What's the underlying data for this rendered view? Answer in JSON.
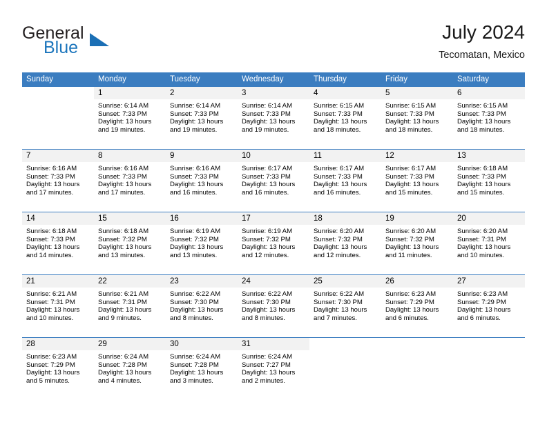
{
  "brand": {
    "word1": "General",
    "word2": "Blue",
    "triangle_icon": "triangle-icon",
    "color_dark": "#231f20",
    "color_blue": "#1b75bc"
  },
  "header": {
    "title": "July 2024",
    "subtitle": "Tecomatan, Mexico"
  },
  "theme": {
    "header_bg": "#3b7dc0",
    "daynum_bg": "#f2f2f2",
    "grid_line": "#3b7dc0"
  },
  "weekday_headers": [
    "Sunday",
    "Monday",
    "Tuesday",
    "Wednesday",
    "Thursday",
    "Friday",
    "Saturday"
  ],
  "weeks": [
    [
      {
        "day": "",
        "blank": true,
        "sunrise": "",
        "sunset": "",
        "daylight1": "",
        "daylight2": ""
      },
      {
        "day": "1",
        "sunrise": "Sunrise: 6:14 AM",
        "sunset": "Sunset: 7:33 PM",
        "daylight1": "Daylight: 13 hours",
        "daylight2": "and 19 minutes."
      },
      {
        "day": "2",
        "sunrise": "Sunrise: 6:14 AM",
        "sunset": "Sunset: 7:33 PM",
        "daylight1": "Daylight: 13 hours",
        "daylight2": "and 19 minutes."
      },
      {
        "day": "3",
        "sunrise": "Sunrise: 6:14 AM",
        "sunset": "Sunset: 7:33 PM",
        "daylight1": "Daylight: 13 hours",
        "daylight2": "and 19 minutes."
      },
      {
        "day": "4",
        "sunrise": "Sunrise: 6:15 AM",
        "sunset": "Sunset: 7:33 PM",
        "daylight1": "Daylight: 13 hours",
        "daylight2": "and 18 minutes."
      },
      {
        "day": "5",
        "sunrise": "Sunrise: 6:15 AM",
        "sunset": "Sunset: 7:33 PM",
        "daylight1": "Daylight: 13 hours",
        "daylight2": "and 18 minutes."
      },
      {
        "day": "6",
        "sunrise": "Sunrise: 6:15 AM",
        "sunset": "Sunset: 7:33 PM",
        "daylight1": "Daylight: 13 hours",
        "daylight2": "and 18 minutes."
      }
    ],
    [
      {
        "day": "7",
        "sunrise": "Sunrise: 6:16 AM",
        "sunset": "Sunset: 7:33 PM",
        "daylight1": "Daylight: 13 hours",
        "daylight2": "and 17 minutes."
      },
      {
        "day": "8",
        "sunrise": "Sunrise: 6:16 AM",
        "sunset": "Sunset: 7:33 PM",
        "daylight1": "Daylight: 13 hours",
        "daylight2": "and 17 minutes."
      },
      {
        "day": "9",
        "sunrise": "Sunrise: 6:16 AM",
        "sunset": "Sunset: 7:33 PM",
        "daylight1": "Daylight: 13 hours",
        "daylight2": "and 16 minutes."
      },
      {
        "day": "10",
        "sunrise": "Sunrise: 6:17 AM",
        "sunset": "Sunset: 7:33 PM",
        "daylight1": "Daylight: 13 hours",
        "daylight2": "and 16 minutes."
      },
      {
        "day": "11",
        "sunrise": "Sunrise: 6:17 AM",
        "sunset": "Sunset: 7:33 PM",
        "daylight1": "Daylight: 13 hours",
        "daylight2": "and 16 minutes."
      },
      {
        "day": "12",
        "sunrise": "Sunrise: 6:17 AM",
        "sunset": "Sunset: 7:33 PM",
        "daylight1": "Daylight: 13 hours",
        "daylight2": "and 15 minutes."
      },
      {
        "day": "13",
        "sunrise": "Sunrise: 6:18 AM",
        "sunset": "Sunset: 7:33 PM",
        "daylight1": "Daylight: 13 hours",
        "daylight2": "and 15 minutes."
      }
    ],
    [
      {
        "day": "14",
        "sunrise": "Sunrise: 6:18 AM",
        "sunset": "Sunset: 7:33 PM",
        "daylight1": "Daylight: 13 hours",
        "daylight2": "and 14 minutes."
      },
      {
        "day": "15",
        "sunrise": "Sunrise: 6:18 AM",
        "sunset": "Sunset: 7:32 PM",
        "daylight1": "Daylight: 13 hours",
        "daylight2": "and 13 minutes."
      },
      {
        "day": "16",
        "sunrise": "Sunrise: 6:19 AM",
        "sunset": "Sunset: 7:32 PM",
        "daylight1": "Daylight: 13 hours",
        "daylight2": "and 13 minutes."
      },
      {
        "day": "17",
        "sunrise": "Sunrise: 6:19 AM",
        "sunset": "Sunset: 7:32 PM",
        "daylight1": "Daylight: 13 hours",
        "daylight2": "and 12 minutes."
      },
      {
        "day": "18",
        "sunrise": "Sunrise: 6:20 AM",
        "sunset": "Sunset: 7:32 PM",
        "daylight1": "Daylight: 13 hours",
        "daylight2": "and 12 minutes."
      },
      {
        "day": "19",
        "sunrise": "Sunrise: 6:20 AM",
        "sunset": "Sunset: 7:32 PM",
        "daylight1": "Daylight: 13 hours",
        "daylight2": "and 11 minutes."
      },
      {
        "day": "20",
        "sunrise": "Sunrise: 6:20 AM",
        "sunset": "Sunset: 7:31 PM",
        "daylight1": "Daylight: 13 hours",
        "daylight2": "and 10 minutes."
      }
    ],
    [
      {
        "day": "21",
        "sunrise": "Sunrise: 6:21 AM",
        "sunset": "Sunset: 7:31 PM",
        "daylight1": "Daylight: 13 hours",
        "daylight2": "and 10 minutes."
      },
      {
        "day": "22",
        "sunrise": "Sunrise: 6:21 AM",
        "sunset": "Sunset: 7:31 PM",
        "daylight1": "Daylight: 13 hours",
        "daylight2": "and 9 minutes."
      },
      {
        "day": "23",
        "sunrise": "Sunrise: 6:22 AM",
        "sunset": "Sunset: 7:30 PM",
        "daylight1": "Daylight: 13 hours",
        "daylight2": "and 8 minutes."
      },
      {
        "day": "24",
        "sunrise": "Sunrise: 6:22 AM",
        "sunset": "Sunset: 7:30 PM",
        "daylight1": "Daylight: 13 hours",
        "daylight2": "and 8 minutes."
      },
      {
        "day": "25",
        "sunrise": "Sunrise: 6:22 AM",
        "sunset": "Sunset: 7:30 PM",
        "daylight1": "Daylight: 13 hours",
        "daylight2": "and 7 minutes."
      },
      {
        "day": "26",
        "sunrise": "Sunrise: 6:23 AM",
        "sunset": "Sunset: 7:29 PM",
        "daylight1": "Daylight: 13 hours",
        "daylight2": "and 6 minutes."
      },
      {
        "day": "27",
        "sunrise": "Sunrise: 6:23 AM",
        "sunset": "Sunset: 7:29 PM",
        "daylight1": "Daylight: 13 hours",
        "daylight2": "and 6 minutes."
      }
    ],
    [
      {
        "day": "28",
        "sunrise": "Sunrise: 6:23 AM",
        "sunset": "Sunset: 7:29 PM",
        "daylight1": "Daylight: 13 hours",
        "daylight2": "and 5 minutes."
      },
      {
        "day": "29",
        "sunrise": "Sunrise: 6:24 AM",
        "sunset": "Sunset: 7:28 PM",
        "daylight1": "Daylight: 13 hours",
        "daylight2": "and 4 minutes."
      },
      {
        "day": "30",
        "sunrise": "Sunrise: 6:24 AM",
        "sunset": "Sunset: 7:28 PM",
        "daylight1": "Daylight: 13 hours",
        "daylight2": "and 3 minutes."
      },
      {
        "day": "31",
        "sunrise": "Sunrise: 6:24 AM",
        "sunset": "Sunset: 7:27 PM",
        "daylight1": "Daylight: 13 hours",
        "daylight2": "and 2 minutes."
      },
      {
        "day": "",
        "blank": true,
        "sunrise": "",
        "sunset": "",
        "daylight1": "",
        "daylight2": ""
      },
      {
        "day": "",
        "blank": true,
        "sunrise": "",
        "sunset": "",
        "daylight1": "",
        "daylight2": ""
      },
      {
        "day": "",
        "blank": true,
        "sunrise": "",
        "sunset": "",
        "daylight1": "",
        "daylight2": ""
      }
    ]
  ]
}
